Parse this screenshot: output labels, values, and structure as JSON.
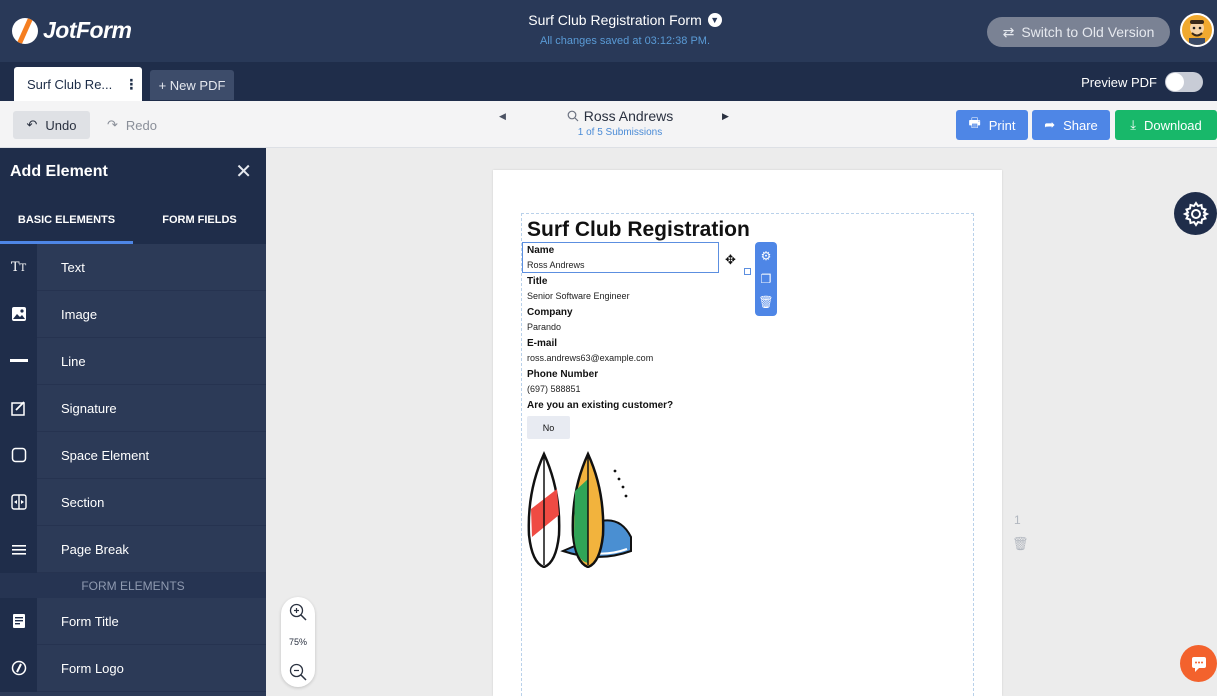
{
  "header": {
    "logo_text": "JotForm",
    "form_title": "Surf Club Registration Form",
    "save_status": "All changes saved at 03:12:38 PM.",
    "switch_label": "Switch to Old Version"
  },
  "tabs": {
    "active": "Surf Club Re...",
    "new_pdf": "+ New PDF",
    "preview_label": "Preview PDF"
  },
  "toolbar": {
    "undo": "Undo",
    "redo": "Redo",
    "submission_name": "Ross Andrews",
    "submission_count": "1 of 5 Submissions",
    "print": "Print",
    "share": "Share",
    "download": "Download"
  },
  "panel": {
    "title": "Add Element",
    "tab_basic": "BASIC ELEMENTS",
    "tab_fields": "FORM FIELDS",
    "basic_items": [
      {
        "label": "Text",
        "icon": "text-icon"
      },
      {
        "label": "Image",
        "icon": "image-icon"
      },
      {
        "label": "Line",
        "icon": "line-icon"
      },
      {
        "label": "Signature",
        "icon": "signature-icon"
      },
      {
        "label": "Space Element",
        "icon": "space-icon"
      },
      {
        "label": "Section",
        "icon": "section-icon"
      },
      {
        "label": "Page Break",
        "icon": "page-break-icon"
      }
    ],
    "form_elements_header": "FORM ELEMENTS",
    "form_items": [
      {
        "label": "Form Title",
        "icon": "form-title-icon"
      },
      {
        "label": "Form Logo",
        "icon": "form-logo-icon"
      }
    ]
  },
  "zoom": {
    "level": "75%"
  },
  "page": {
    "heading": "Surf Club Registration",
    "fields": [
      {
        "label": "Name",
        "value": "Ross Andrews"
      },
      {
        "label": "Title",
        "value": "Senior Software Engineer"
      },
      {
        "label": "Company",
        "value": "Parando"
      },
      {
        "label": "E-mail",
        "value": "ross.andrews63@example.com"
      },
      {
        "label": "Phone Number",
        "value": "(697) 588851"
      }
    ],
    "question": "Are you an existing customer?",
    "answer": "No",
    "page_number": "1"
  },
  "colors": {
    "header_bg": "#293958",
    "panel_bg": "#2c3a57",
    "accent_blue": "#4e86e6",
    "download_green": "#18b86a",
    "brand_orange": "#f57e20"
  }
}
